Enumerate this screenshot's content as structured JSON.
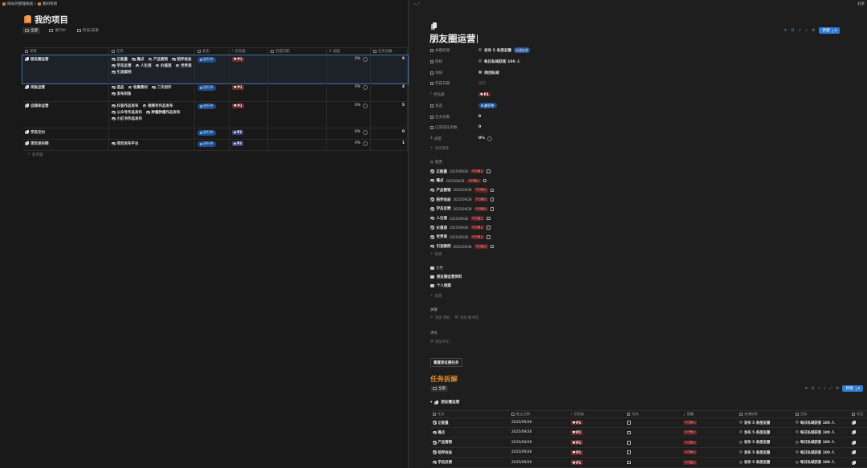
{
  "breadcrumb": {
    "workspace": "阳光的管理系统",
    "page": "我的项目"
  },
  "left": {
    "title": "我的项目",
    "tabs": [
      {
        "label": "全部"
      },
      {
        "label": "进行中"
      },
      {
        "label": "阶段/未来"
      }
    ],
    "new_label": "新建",
    "columns": [
      "项目",
      "任务",
      "状态",
      "优先级",
      "完成日期",
      "进度",
      "任务总数"
    ],
    "rows": [
      {
        "name": "朋友圈运营",
        "tasks": [
          "正能量",
          "痛点",
          "产品营销",
          "陪伴收益",
          "学员反馈",
          "人生观",
          "价值观",
          "世界观",
          "引流案例"
        ],
        "status": "进行中",
        "priority": "P1",
        "progress": "0%",
        "total": "9"
      },
      {
        "name": "闲鱼运营",
        "tasks": [
          "选品",
          "收集素材",
          "二次创作",
          "发布闲鱼"
        ],
        "status": "进行中",
        "priority": "P1",
        "progress": "0%",
        "total": "4"
      },
      {
        "name": "自媒体运营",
        "tasks": [
          "抖音作品发布",
          "视频号作品发布",
          "公众号作品发布",
          "肿瘤肿瘤作品发布",
          "小红书作品发布"
        ],
        "status": "进行中",
        "priority": "P1",
        "progress": "0%",
        "total": "5"
      },
      {
        "name": "学员交付",
        "tasks": [],
        "status": "进行中",
        "priority": "P2",
        "progress": "0%",
        "total": "0"
      },
      {
        "name": "项目发布网",
        "tasks": [
          "项目发布平台"
        ],
        "status": "进行中",
        "priority": "P2",
        "progress": "0%",
        "total": "1"
      }
    ],
    "add_page": "新页面"
  },
  "right": {
    "share": "分享",
    "title": "朋友圈运营",
    "props": {
      "key_result_label": "关键结果",
      "key_result": "发布 5 条朋友圈",
      "key_result_tag": "关键结果",
      "goal_label": "目标",
      "goal": "每日私域获客 100 人",
      "area_label": "领域",
      "area": "网创私域",
      "date_label": "完成日期",
      "date": "空白",
      "priority_label": "优先级",
      "priority": "P1",
      "status_label": "状态",
      "status": "进行中",
      "total_label": "任务总数",
      "total": "9",
      "done_label": "已完成任务数",
      "done": "0",
      "progress_label": "进度",
      "progress": "0%",
      "add_prop": "添加属性"
    },
    "tasks_label": "任务",
    "tasks": [
      {
        "name": "正能量",
        "date": "2025/09/28",
        "flag": "今日截止"
      },
      {
        "name": "痛点",
        "date": "2025/09/28",
        "flag": "今日截止"
      },
      {
        "name": "产品营销",
        "date": "2025/09/28",
        "flag": "今日截止"
      },
      {
        "name": "陪伴收益",
        "date": "2025/09/28",
        "flag": "今日截止"
      },
      {
        "name": "学员反馈",
        "date": "2025/09/28",
        "flag": "今日截止"
      },
      {
        "name": "人生观",
        "date": "2025/09/28",
        "flag": "今日截止"
      },
      {
        "name": "价值观",
        "date": "2025/09/28",
        "flag": "今日截止"
      },
      {
        "name": "世界观",
        "date": "2025/09/28",
        "flag": "今日截止"
      },
      {
        "name": "引流案例",
        "date": "2025/09/28",
        "flag": "今日截止"
      }
    ],
    "add_new": "新建",
    "docs_label": "文档",
    "docs": [
      "朋友圈运营资料",
      "个人档案"
    ],
    "related_label": "关联",
    "related_add": "添加 课程",
    "related_add2": "添加 图书馆",
    "comments_label": "评论",
    "comment_placeholder": "添加评论...",
    "reset_btn": "重置朋友圈任务",
    "breakdown_title": "任务拆解",
    "breakdown_tab": "全部",
    "group_name": "朋友圈运营",
    "table_cols": [
      "任务",
      "截止日期",
      "优先级",
      "完成",
      "提醒",
      "关键结果",
      "目标",
      "项目"
    ],
    "table_rows": [
      {
        "name": "正能量",
        "date": "2025/09/28",
        "priority": "P1",
        "flag": "今日截止",
        "kr": "发布 5 条朋友圈",
        "goal": "每日私域获客 100 人"
      },
      {
        "name": "痛点",
        "date": "2025/09/28",
        "priority": "P1",
        "flag": "今日截止",
        "kr": "发布 5 条朋友圈",
        "goal": "每日私域获客 100 人"
      },
      {
        "name": "产品营销",
        "date": "2025/09/28",
        "priority": "P1",
        "flag": "今日截止",
        "kr": "发布 5 条朋友圈",
        "goal": "每日私域获客 100 人"
      },
      {
        "name": "陪伴收益",
        "date": "2025/09/28",
        "priority": "P1",
        "flag": "今日截止",
        "kr": "发布 5 条朋友圈",
        "goal": "每日私域获客 100 人"
      },
      {
        "name": "学员反馈",
        "date": "2025/09/28",
        "priority": "P1",
        "flag": "今日截止",
        "kr": "发布 5 条朋友圈",
        "goal": "每日私域获客 100 人"
      }
    ]
  }
}
